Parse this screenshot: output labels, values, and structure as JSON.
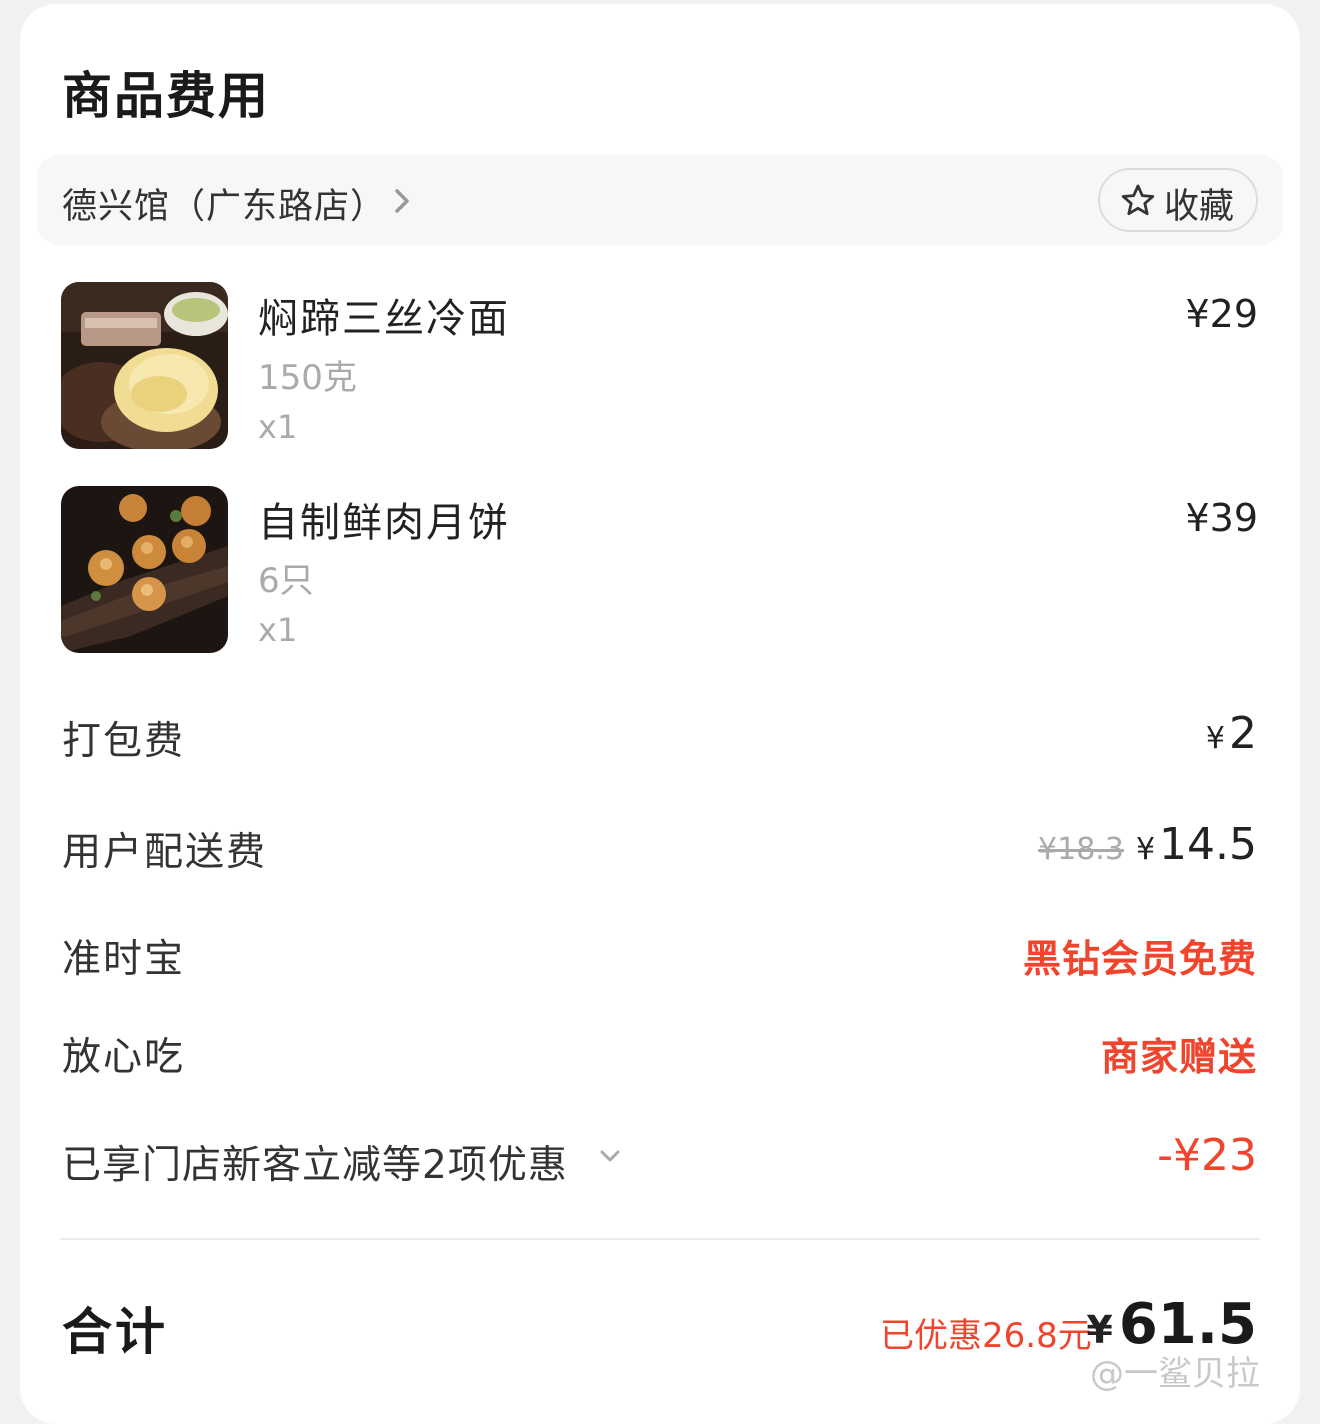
{
  "section": {
    "title": "商品费用"
  },
  "store": {
    "name": "德兴馆（广东路店）",
    "favorite_label": "收藏"
  },
  "items": [
    {
      "name": "焖蹄三丝冷面",
      "spec": "150克",
      "qty": "x1",
      "price": "¥29",
      "image": "cold-noodle-dish-photo"
    },
    {
      "name": "自制鲜肉月饼",
      "spec": "6只",
      "qty": "x1",
      "price": "¥39",
      "image": "fresh-meat-mooncake-photo"
    }
  ],
  "fees": {
    "packing": {
      "label": "打包费",
      "currency": "¥",
      "amount": "2"
    },
    "delivery": {
      "label": "用户配送费",
      "original": "¥18.3",
      "currency": "¥",
      "amount": "14.5"
    },
    "ontime": {
      "label": "准时宝",
      "value": "黑钻会员免费"
    },
    "assurance": {
      "label": "放心吃",
      "value": "商家赠送"
    },
    "discount": {
      "label": "已享门店新客立减等2项优惠",
      "value": "-¥23"
    }
  },
  "total": {
    "label": "合计",
    "saved": "已优惠26.8元",
    "currency": "¥",
    "amount": "61.5"
  },
  "watermark": "@一鲨贝拉",
  "colors": {
    "accent_red": "#f0442c",
    "card": "#ffffff",
    "page_bg": "#f2f2f2"
  }
}
